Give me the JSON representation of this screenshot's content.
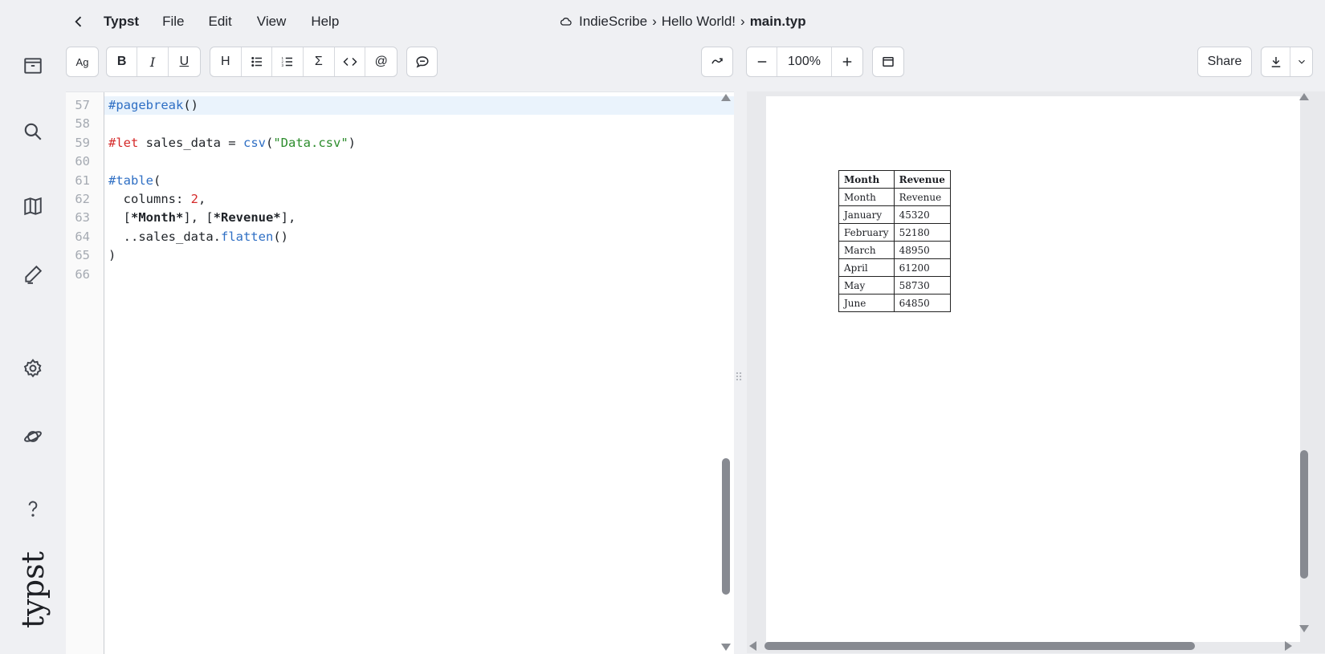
{
  "app": {
    "name": "Typst",
    "brand_text": "typst"
  },
  "menu": {
    "items": [
      "File",
      "Edit",
      "View",
      "Help"
    ]
  },
  "breadcrumb": {
    "project": "IndieScribe",
    "folder": "Hello World!",
    "file": "main.typ"
  },
  "toolbar": {
    "font_label": "Ag",
    "bold": "B",
    "italic": "I",
    "underline": "U",
    "heading": "H",
    "math": "Σ",
    "reference": "@",
    "zoom_value": "100%",
    "share_label": "Share"
  },
  "editor": {
    "lines": [
      {
        "num": "57",
        "segments": [
          {
            "t": "#pagebreak",
            "c": "k-blue"
          },
          {
            "t": "()",
            "c": ""
          }
        ]
      },
      {
        "num": "58",
        "segments": []
      },
      {
        "num": "59",
        "segments": [
          {
            "t": "#let",
            "c": "k-red"
          },
          {
            "t": " sales_data = ",
            "c": ""
          },
          {
            "t": "csv",
            "c": "k-blue"
          },
          {
            "t": "(",
            "c": ""
          },
          {
            "t": "\"Data.csv\"",
            "c": "k-str"
          },
          {
            "t": ")",
            "c": ""
          }
        ]
      },
      {
        "num": "60",
        "segments": []
      },
      {
        "num": "61",
        "segments": [
          {
            "t": "#table",
            "c": "k-blue"
          },
          {
            "t": "(",
            "c": ""
          }
        ]
      },
      {
        "num": "62",
        "segments": [
          {
            "t": "  columns: ",
            "c": ""
          },
          {
            "t": "2",
            "c": "k-num"
          },
          {
            "t": ",",
            "c": ""
          }
        ]
      },
      {
        "num": "63",
        "segments": [
          {
            "t": "  [",
            "c": ""
          },
          {
            "t": "*Month*",
            "c": "bold"
          },
          {
            "t": "], [",
            "c": ""
          },
          {
            "t": "*Revenue*",
            "c": "bold"
          },
          {
            "t": "],",
            "c": ""
          }
        ]
      },
      {
        "num": "64",
        "segments": [
          {
            "t": "  ..sales_data.",
            "c": ""
          },
          {
            "t": "flatten",
            "c": "k-blue"
          },
          {
            "t": "()",
            "c": ""
          }
        ]
      },
      {
        "num": "65",
        "segments": [
          {
            "t": ")",
            "c": ""
          }
        ]
      },
      {
        "num": "66",
        "segments": []
      }
    ]
  },
  "preview_table": {
    "headers": [
      "Month",
      "Revenue"
    ],
    "rows": [
      [
        "Month",
        "Revenue"
      ],
      [
        "January",
        "45320"
      ],
      [
        "February",
        "52180"
      ],
      [
        "March",
        "48950"
      ],
      [
        "April",
        "61200"
      ],
      [
        "May",
        "58730"
      ],
      [
        "June",
        "64850"
      ]
    ]
  },
  "colors": {
    "accent": "#2f6fc4",
    "keyword": "#d52a2a",
    "string": "#2c8c2c",
    "active_line": "#eaf3fc"
  }
}
